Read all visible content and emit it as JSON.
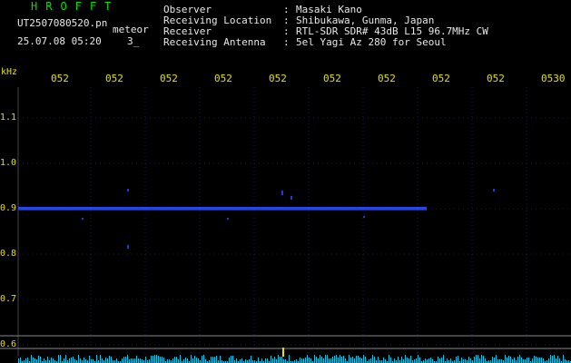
{
  "header": {
    "logo": "HROFFT",
    "filename": "UT2507080520.pn",
    "meteor_label": "meteor",
    "datetime": "25.07.08 05:20",
    "count": "3_",
    "fields": [
      {
        "label": "Observer",
        "value": "Masaki Kano"
      },
      {
        "label": "Receiving Location",
        "value": "Shibukawa, Gunma, Japan"
      },
      {
        "label": "Receiver",
        "value": "RTL-SDR SDR# 43dB L15 96.7MHz CW"
      },
      {
        "label": "Receiving Antenna",
        "value": "5el Yagi Az 280 for Seoul"
      }
    ]
  },
  "axes": {
    "y_unit": "kHz",
    "time_ticks": [
      "052",
      "052",
      "052",
      "052",
      "052",
      "052",
      "052",
      "052",
      "052",
      "0530"
    ],
    "freq_ticks": [
      "1.1",
      "1.0",
      "0.9",
      "0.8",
      "0.7",
      "0.6"
    ]
  },
  "colors": {
    "background": "#000000",
    "grid": "#1c1c4a",
    "signal": "#2a4cff",
    "tick_color": "#e8e000",
    "level_bars": "#00c8e8"
  }
}
